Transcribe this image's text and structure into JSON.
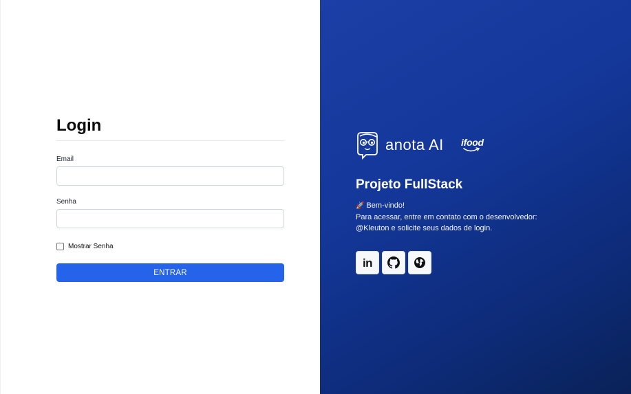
{
  "login": {
    "title": "Login",
    "email_label": "Email",
    "email_value": "",
    "password_label": "Senha",
    "password_value": "",
    "show_password_label": "Mostrar Senha",
    "submit_label": "ENTRAR"
  },
  "brand": {
    "anota_name": "anota AI",
    "ifood_name": "ifood"
  },
  "info": {
    "title": "Projeto FullStack",
    "welcome": "Bem-vindo!",
    "message": "Para acessar, entre em contato com o desenvolvedor: @Kleuton e solicite seus dados de login."
  },
  "socials": [
    {
      "icon": "linkedin-icon",
      "text": "in"
    },
    {
      "icon": "github-icon"
    },
    {
      "icon": "globe-icon"
    }
  ],
  "colors": {
    "primary_button": "#2563eb",
    "panel_gradient_start": "#1b3fa6",
    "panel_gradient_end": "#0a2258"
  }
}
